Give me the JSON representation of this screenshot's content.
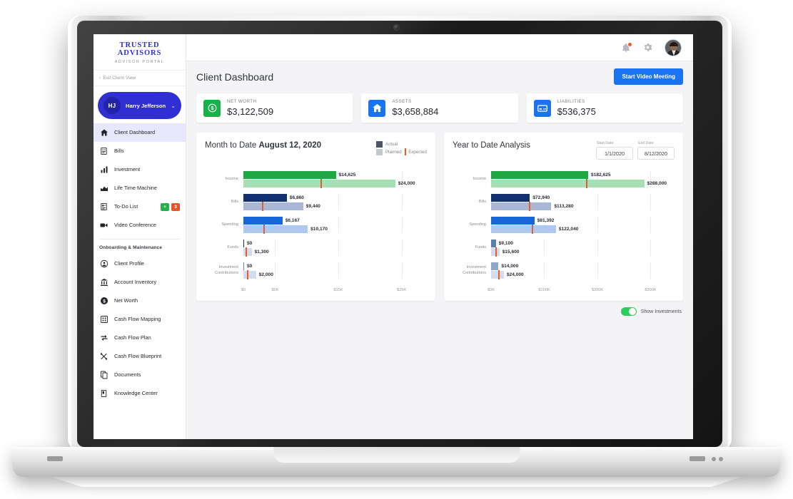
{
  "brand": {
    "title": "TRUSTED ADVISORS",
    "subtitle": "ADVISOR PORTAL"
  },
  "exit_client_view": "Exit Client View",
  "user": {
    "initials": "HJ",
    "name": "Harry Jefferson"
  },
  "sidebar": {
    "items": [
      {
        "label": "Client Dashboard",
        "icon": "home-icon",
        "active": true
      },
      {
        "label": "Bills",
        "icon": "bills-icon",
        "active": false
      },
      {
        "label": "Investment",
        "icon": "investment-icon",
        "active": false
      },
      {
        "label": "Life Time Machine",
        "icon": "life-time-machine-icon",
        "active": false
      },
      {
        "label": "To-Do List",
        "icon": "todo-icon",
        "active": false,
        "badges": [
          {
            "text": "+",
            "color": "#25b24b"
          },
          {
            "text": "3",
            "color": "#e2552c"
          }
        ]
      },
      {
        "label": "Video Conference",
        "icon": "video-camera-icon",
        "active": false
      }
    ],
    "section_label": "Onboarding & Maintenance",
    "items2": [
      {
        "label": "Client Profile",
        "icon": "person-icon"
      },
      {
        "label": "Account Inventory",
        "icon": "bank-icon"
      },
      {
        "label": "Net Worth",
        "icon": "dollar-coin-icon"
      },
      {
        "label": "Cash Flow Mapping",
        "icon": "grid-icon"
      },
      {
        "label": "Cash Flow Plan",
        "icon": "shuffle-icon"
      },
      {
        "label": "Cash Flow Blueprint",
        "icon": "blueprint-icon"
      },
      {
        "label": "Documents",
        "icon": "documents-icon"
      },
      {
        "label": "Knowledge Center",
        "icon": "book-icon"
      }
    ]
  },
  "topbar": {
    "bell": "bell-icon",
    "gear": "gear-icon",
    "avatar": "user-avatar"
  },
  "page": {
    "title": "Client Dashboard",
    "cta": "Start Video Meeting"
  },
  "kpis": [
    {
      "label": "NET WORTH",
      "value": "$3,122,509",
      "icon": "dollar-circle-icon",
      "color": "#17b24a"
    },
    {
      "label": "ASSETS",
      "value": "$3,658,884",
      "icon": "home-icon",
      "color": "#1a73f0"
    },
    {
      "label": "LIABILITIES",
      "value": "$536,375",
      "icon": "credit-card-icon",
      "color": "#1a73f0"
    }
  ],
  "legend": {
    "actual": "Actual",
    "planned": "Planned",
    "expected": "Expected"
  },
  "mtd": {
    "title_prefix": "Month to Date ",
    "title_bold": "August 12, 2020"
  },
  "ytd": {
    "title": "Year to Date Analysis",
    "start_label": "Start Date",
    "start_value": "1/1/2020",
    "end_label": "End Date",
    "end_value": "8/12/2020"
  },
  "toggle": {
    "label": "Show Investments",
    "on": true,
    "color": "#2ecc5a"
  },
  "chart_data": [
    {
      "type": "bar",
      "id": "month-to-date",
      "orientation": "horizontal",
      "title": "Month to Date August 12, 2020",
      "xlabel": "",
      "ylabel": "",
      "xlim": [
        0,
        29000
      ],
      "grid": true,
      "legend": [
        "Actual",
        "Planned",
        "Expected"
      ],
      "tick_values": [
        0,
        5000,
        15000,
        25000
      ],
      "tick_labels": [
        "$0",
        "$5K",
        "$15K",
        "$25K"
      ],
      "categories": [
        "Income",
        "Bills",
        "Spending",
        "Funds",
        "Investment Contributions"
      ],
      "series": [
        {
          "name": "Actual",
          "values": [
            14625,
            6860,
            6167,
            0,
            0
          ]
        },
        {
          "name": "Planned",
          "values": [
            24000,
            9440,
            10170,
            1300,
            2000
          ]
        },
        {
          "name": "Expected",
          "values": [
            12300,
            3020,
            3250,
            430,
            660
          ]
        }
      ],
      "labels": {
        "actual": [
          "$14,625",
          "$6,860",
          "$6,167",
          "$0",
          "$0"
        ],
        "planned": [
          "$24,000",
          "$9,440",
          "$10,170",
          "$1,300",
          "$2,000"
        ]
      },
      "colors": {
        "Income": {
          "actual": "#1fa744",
          "planned": "#a6dfb4"
        },
        "Bills": {
          "actual": "#12306e",
          "planned": "#a9b7d4"
        },
        "Spending": {
          "actual": "#1767d8",
          "planned": "#afc8ee"
        },
        "Funds": {
          "actual": "#12306e",
          "planned": "#d3ddee"
        },
        "Investment Contributions": {
          "actual": "#5d7fae",
          "planned": "#d3ddee"
        },
        "expected_marker": "#f0592b"
      }
    },
    {
      "type": "bar",
      "id": "year-to-date",
      "orientation": "horizontal",
      "title": "Year to Date Analysis",
      "xlabel": "",
      "ylabel": "",
      "xlim": [
        0,
        345000
      ],
      "grid": true,
      "legend": [
        "Actual",
        "Planned",
        "Expected"
      ],
      "tick_values": [
        0,
        100000,
        200000,
        300000
      ],
      "tick_labels": [
        "$0K",
        "$100K",
        "$200K",
        "$300K"
      ],
      "categories": [
        "Income",
        "Bills",
        "Spending",
        "Funds",
        "Investment Contributions"
      ],
      "series": [
        {
          "name": "Actual",
          "values": [
            182625,
            72940,
            81392,
            9100,
            14000
          ]
        },
        {
          "name": "Planned",
          "values": [
            288000,
            113280,
            122040,
            15600,
            24000
          ]
        },
        {
          "name": "Expected",
          "values": [
            180000,
            72000,
            78000,
            9800,
            15200
          ]
        }
      ],
      "labels": {
        "actual": [
          "$182,625",
          "$72,940",
          "$81,392",
          "$9,100",
          "$14,000"
        ],
        "planned": [
          "$288,000",
          "$113,280",
          "$122,040",
          "$15,600",
          "$24,000"
        ]
      },
      "colors": {
        "Income": {
          "actual": "#1fa744",
          "planned": "#a6dfb4"
        },
        "Bills": {
          "actual": "#12306e",
          "planned": "#a9b7d4"
        },
        "Spending": {
          "actual": "#1767d8",
          "planned": "#afc8ee"
        },
        "Funds": {
          "actual": "#5d7fae",
          "planned": "#d3ddee"
        },
        "Investment Contributions": {
          "actual": "#8fa8c9",
          "planned": "#d3ddee"
        },
        "expected_marker": "#f0592b"
      }
    }
  ]
}
